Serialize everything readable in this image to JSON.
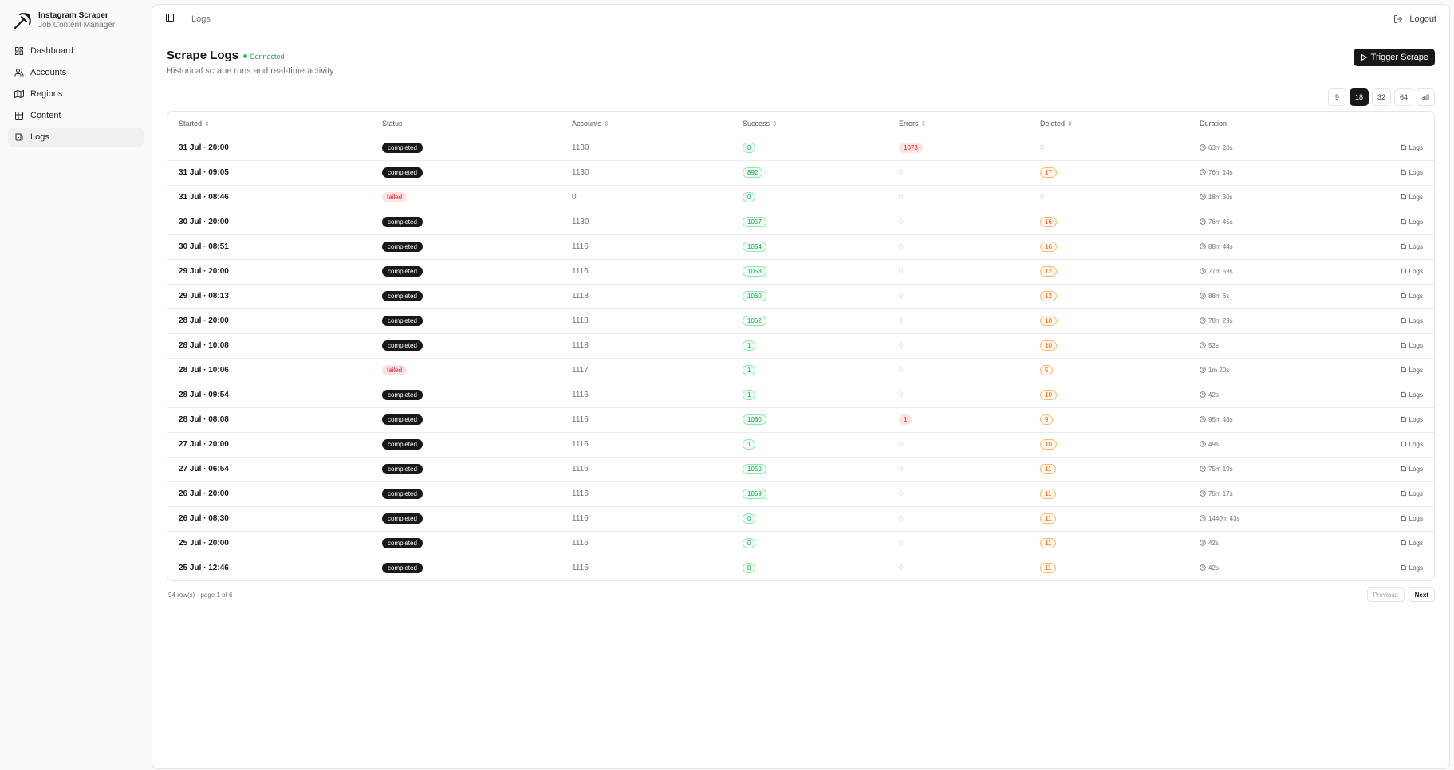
{
  "brand": {
    "title": "Instagram Scraper",
    "subtitle": "Job Content Manager"
  },
  "sidebar": {
    "items": [
      {
        "label": "Dashboard",
        "icon": "dashboard-icon",
        "active": false
      },
      {
        "label": "Accounts",
        "icon": "users-icon",
        "active": false
      },
      {
        "label": "Regions",
        "icon": "map-icon",
        "active": false
      },
      {
        "label": "Content",
        "icon": "content-icon",
        "active": false
      },
      {
        "label": "Logs",
        "icon": "logs-icon",
        "active": true
      }
    ]
  },
  "topbar": {
    "breadcrumb": "Logs",
    "logout_label": "Logout"
  },
  "page": {
    "title": "Scrape Logs",
    "connection_status": "Connected",
    "subtitle": "Historical scrape runs and real-time activity",
    "trigger_label": "Trigger Scrape"
  },
  "page_sizes": {
    "options": [
      "9",
      "18",
      "32",
      "64",
      "all"
    ],
    "selected": "18"
  },
  "table": {
    "columns": [
      "Started",
      "Status",
      "Accounts",
      "Success",
      "Errors",
      "Deleted",
      "Duration"
    ],
    "logs_label": "Logs",
    "rows": [
      {
        "started": "31 Jul · 20:00",
        "status": "completed",
        "accounts": "1130",
        "success": "0",
        "errors": "1073",
        "deleted": "0",
        "duration": "63m 20s"
      },
      {
        "started": "31 Jul · 09:05",
        "status": "completed",
        "accounts": "1130",
        "success": "892",
        "errors": "0",
        "deleted": "17",
        "duration": "76m 14s"
      },
      {
        "started": "31 Jul · 08:46",
        "status": "failed",
        "accounts": "0",
        "success": "0",
        "errors": "0",
        "deleted": "0",
        "duration": "18m 30s"
      },
      {
        "started": "30 Jul · 20:00",
        "status": "completed",
        "accounts": "1130",
        "success": "1057",
        "errors": "0",
        "deleted": "16",
        "duration": "76m 45s"
      },
      {
        "started": "30 Jul · 08:51",
        "status": "completed",
        "accounts": "1116",
        "success": "1054",
        "errors": "0",
        "deleted": "16",
        "duration": "88m 44s"
      },
      {
        "started": "29 Jul · 20:00",
        "status": "completed",
        "accounts": "1116",
        "success": "1058",
        "errors": "0",
        "deleted": "12",
        "duration": "77m 59s"
      },
      {
        "started": "29 Jul · 08:13",
        "status": "completed",
        "accounts": "1118",
        "success": "1060",
        "errors": "0",
        "deleted": "12",
        "duration": "88m 6s"
      },
      {
        "started": "28 Jul · 20:00",
        "status": "completed",
        "accounts": "1118",
        "success": "1062",
        "errors": "0",
        "deleted": "10",
        "duration": "78m 29s"
      },
      {
        "started": "28 Jul · 10:08",
        "status": "completed",
        "accounts": "1118",
        "success": "1",
        "errors": "0",
        "deleted": "10",
        "duration": "52s"
      },
      {
        "started": "28 Jul · 10:06",
        "status": "failed",
        "accounts": "1117",
        "success": "1",
        "errors": "0",
        "deleted": "5",
        "duration": "1m 20s"
      },
      {
        "started": "28 Jul · 09:54",
        "status": "completed",
        "accounts": "1116",
        "success": "1",
        "errors": "0",
        "deleted": "10",
        "duration": "42s"
      },
      {
        "started": "28 Jul · 08:08",
        "status": "completed",
        "accounts": "1116",
        "success": "1060",
        "errors": "1",
        "deleted": "9",
        "duration": "95m 48s"
      },
      {
        "started": "27 Jul · 20:00",
        "status": "completed",
        "accounts": "1116",
        "success": "1",
        "errors": "0",
        "deleted": "10",
        "duration": "49s"
      },
      {
        "started": "27 Jul · 06:54",
        "status": "completed",
        "accounts": "1116",
        "success": "1059",
        "errors": "0",
        "deleted": "11",
        "duration": "75m 19s"
      },
      {
        "started": "26 Jul · 20:00",
        "status": "completed",
        "accounts": "1116",
        "success": "1059",
        "errors": "0",
        "deleted": "11",
        "duration": "75m 17s"
      },
      {
        "started": "26 Jul · 08:30",
        "status": "completed",
        "accounts": "1116",
        "success": "0",
        "errors": "0",
        "deleted": "11",
        "duration": "1440m 43s"
      },
      {
        "started": "25 Jul · 20:00",
        "status": "completed",
        "accounts": "1116",
        "success": "0",
        "errors": "0",
        "deleted": "11",
        "duration": "42s"
      },
      {
        "started": "25 Jul · 12:46",
        "status": "completed",
        "accounts": "1116",
        "success": "0",
        "errors": "0",
        "deleted": "11",
        "duration": "42s"
      }
    ]
  },
  "footer": {
    "row_info": "94 row(s) · page 1 of 6",
    "previous_label": "Previous",
    "next_label": "Next"
  },
  "colors": {
    "accent": "#18181b",
    "success": "#16a34a",
    "error": "#dc2626",
    "warning": "#ea580c"
  }
}
